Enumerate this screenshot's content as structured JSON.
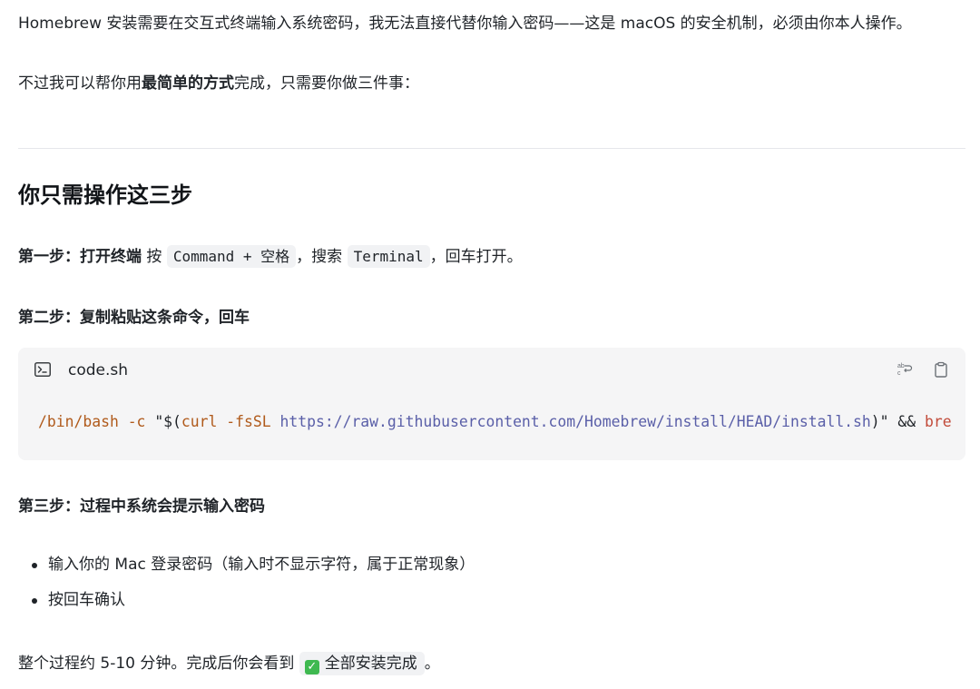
{
  "intro": {
    "line1": "Homebrew 安装需要在交互式终端输入系统密码，我无法直接代替你输入密码——这是 macOS 的安全机制，必须由你本人操作。",
    "line2_pre": "不过我可以帮你用",
    "line2_bold": "最简单的方式",
    "line2_post": "完成，只需要你做三件事："
  },
  "section": {
    "title": "你只需操作这三步"
  },
  "step1": {
    "label": "第一步：打开终端",
    "text_a": " 按 ",
    "code_a": "Command + 空格",
    "text_b": "，搜索 ",
    "code_b": "Terminal",
    "text_c": "，回车打开。"
  },
  "step2": {
    "label": "第二步：复制粘贴这条命令，回车"
  },
  "codeblock": {
    "filename": "code.sh",
    "icons": {
      "terminal": "terminal-icon",
      "wrap": "word-wrap-icon",
      "copy": "clipboard-icon"
    },
    "tokens": {
      "cmd": "/bin/bash",
      "flag_c": "-c",
      "open": "\"$(",
      "curl": "curl",
      "flag_fssl": "-fsSL",
      "url": "https://raw.githubusercontent.com/Homebrew/install/HEAD/install.sh",
      "close": ")\"",
      "and": "&&",
      "tail": "bre"
    }
  },
  "step3": {
    "label": "第三步：过程中系统会提示输入密码",
    "bullets": [
      "输入你的 Mac 登录密码（输入时不显示字符，属于正常现象）",
      "按回车确认"
    ]
  },
  "final": {
    "text_pre": "整个过程约 5-10 分钟。完成后你会看到 ",
    "chip_icon": "✓",
    "chip_text": "全部安装完成",
    "text_post": "。"
  },
  "colors": {
    "code_bg": "#f5f5f6",
    "inline_code_bg": "#f1f2f4",
    "token_cmd": "#b05a1b",
    "token_url": "#5a5fa8",
    "check_green": "#3fb950"
  }
}
